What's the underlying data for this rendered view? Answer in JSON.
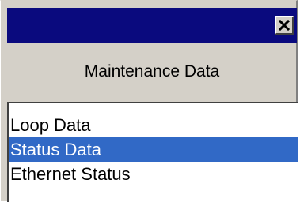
{
  "window": {
    "title_bar_color": "#0a0a7e",
    "close_icon": "close-x-icon"
  },
  "header": {
    "title": "Maintenance Data"
  },
  "list": {
    "items": [
      {
        "label": "Loop Data",
        "selected": false
      },
      {
        "label": "Status Data",
        "selected": true
      },
      {
        "label": "Ethernet Status",
        "selected": false
      }
    ],
    "selection_color": "#3169c6"
  }
}
